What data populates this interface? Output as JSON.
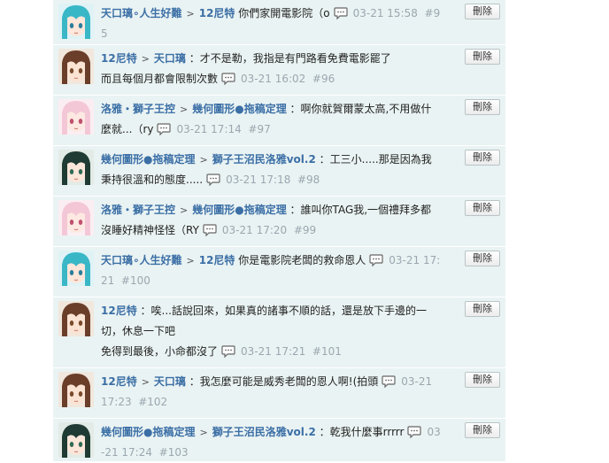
{
  "delete_label": "刪除",
  "comments": [
    {
      "avatar": "teal-hair-avatar",
      "author": "天口璃∘人生好難",
      "target": "12尼特",
      "text": "你們家開電影院（o",
      "text2": "",
      "date": "03-21 15:58",
      "num": "#95"
    },
    {
      "avatar": "brown-hair-avatar",
      "author": "12尼特",
      "target": "天口璃",
      "text": "：才不是勒，我指是有門路看免費電影罷了",
      "text2": "而且每個月都會限制次數",
      "date": "03-21 16:02",
      "num": "#96"
    },
    {
      "avatar": "pink-hair-avatar",
      "author": "洛雅・獅子王控",
      "target": "幾何圖形●拖稿定理",
      "text": "：啊你就賀爾蒙太高,不用做什麼就...（ry",
      "text2": "",
      "date": "03-21 17:14",
      "num": "#97"
    },
    {
      "avatar": "dark-hat-avatar",
      "author": "幾何圖形●拖稿定理",
      "target": "獅子王沼民洛雅vol.2",
      "text": "：工三小.....那是因為我秉持很溫和的態度.....",
      "text2": "",
      "date": "03-21 17:18",
      "num": "#98"
    },
    {
      "avatar": "pink-hair-avatar",
      "author": "洛雅・獅子王控",
      "target": "幾何圖形●拖稿定理",
      "text": "：誰叫你TAG我,一個禮拜多都沒睡好精神怪怪（RY",
      "text2": "",
      "date": "03-21 17:20",
      "num": "#99"
    },
    {
      "avatar": "teal-hair-avatar",
      "author": "天口璃∘人生好難",
      "target": "12尼特",
      "text": "你是電影院老闆的救命恩人",
      "text2": "",
      "date": "03-21 17:21",
      "num": "#100"
    },
    {
      "avatar": "brown-hair-avatar",
      "author": "12尼特",
      "target": "",
      "text": "：唉...話說回來，如果真的諸事不順的話，還是放下手邊的一切，休息一下吧",
      "text2": "免得到最後，小命都沒了",
      "date": "03-21 17:21",
      "num": "#101"
    },
    {
      "avatar": "brown-hair-avatar",
      "author": "12尼特",
      "target": "天口璃",
      "text": "：我怎麼可能是威秀老闆的恩人啊!(拍頭",
      "text2": "",
      "date": "03-21 17:23",
      "num": "#102"
    },
    {
      "avatar": "dark-hat-avatar",
      "author": "幾何圖形●拖稿定理",
      "target": "獅子王沼民洛雅vol.2",
      "text": "：乾我什麼事rrrrr",
      "text2": "",
      "date": "03-21 17:24",
      "num": "#103"
    }
  ]
}
